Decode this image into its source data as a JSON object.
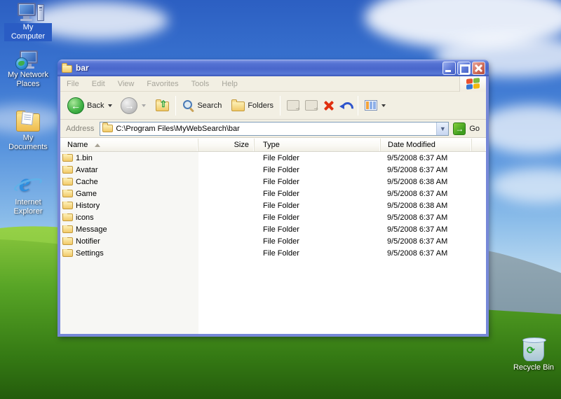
{
  "desktop": {
    "icons": [
      {
        "label": "My Computer",
        "selected": true
      },
      {
        "label": "My Network Places",
        "selected": false
      },
      {
        "label": "My Documents",
        "selected": false
      },
      {
        "label": "Internet Explorer",
        "selected": false
      },
      {
        "label": "Recycle Bin",
        "selected": false
      }
    ]
  },
  "window": {
    "title": "bar",
    "menu": [
      "File",
      "Edit",
      "View",
      "Favorites",
      "Tools",
      "Help"
    ],
    "toolbar": {
      "back": "Back",
      "search": "Search",
      "folders": "Folders"
    },
    "address": {
      "label": "Address",
      "value": "C:\\Program Files\\MyWebSearch\\bar",
      "go": "Go"
    },
    "columns": {
      "name": "Name",
      "size": "Size",
      "type": "Type",
      "modified": "Date Modified"
    },
    "rows": [
      {
        "name": "1.bin",
        "size": "",
        "type": "File Folder",
        "modified": "9/5/2008 6:37 AM"
      },
      {
        "name": "Avatar",
        "size": "",
        "type": "File Folder",
        "modified": "9/5/2008 6:37 AM"
      },
      {
        "name": "Cache",
        "size": "",
        "type": "File Folder",
        "modified": "9/5/2008 6:38 AM"
      },
      {
        "name": "Game",
        "size": "",
        "type": "File Folder",
        "modified": "9/5/2008 6:37 AM"
      },
      {
        "name": "History",
        "size": "",
        "type": "File Folder",
        "modified": "9/5/2008 6:38 AM"
      },
      {
        "name": "icons",
        "size": "",
        "type": "File Folder",
        "modified": "9/5/2008 6:37 AM"
      },
      {
        "name": "Message",
        "size": "",
        "type": "File Folder",
        "modified": "9/5/2008 6:37 AM"
      },
      {
        "name": "Notifier",
        "size": "",
        "type": "File Folder",
        "modified": "9/5/2008 6:37 AM"
      },
      {
        "name": "Settings",
        "size": "",
        "type": "File Folder",
        "modified": "9/5/2008 6:37 AM"
      }
    ]
  },
  "colors": {
    "titlebar_blue": "#4a67cb",
    "window_border": "#7688d8",
    "toolbar_tan": "#f2efe3",
    "selection_blue": "#2a5cc4",
    "delete_red": "#e03010",
    "go_green": "#3f9e1f"
  }
}
